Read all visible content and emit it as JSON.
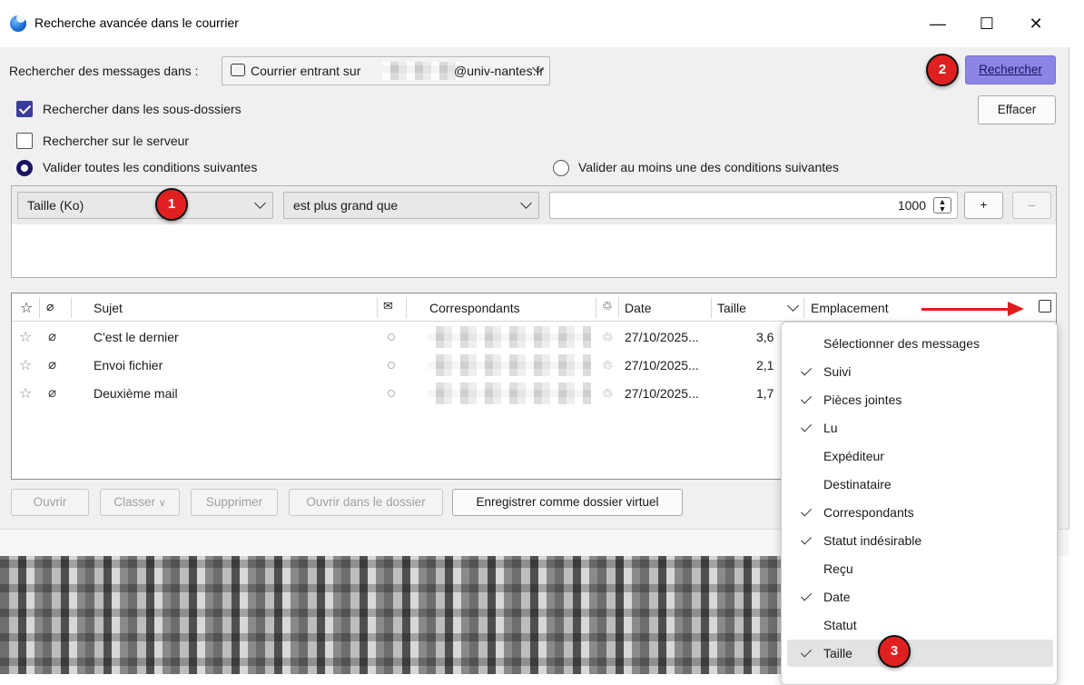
{
  "window": {
    "title": "Recherche avancée dans le courrier",
    "minimize": "—",
    "maximize": "☐",
    "close": "✕"
  },
  "search": {
    "in_label": "Rechercher des messages dans :",
    "folder_prefix": "Courrier entrant sur",
    "folder_suffix": "@univ-nantes.fr",
    "search_button": "Rechercher",
    "clear_button": "Effacer",
    "subfolders_label": "Rechercher dans les sous-dossiers",
    "subfolders_checked": true,
    "server_label": "Rechercher sur le serveur",
    "server_checked": false,
    "match_all_label": "Valider toutes les conditions suivantes",
    "match_any_label": "Valider au moins une des conditions suivantes",
    "match_mode": "all"
  },
  "condition": {
    "field": "Taille (Ko)",
    "operator": "est plus grand que",
    "value": "1000",
    "add": "+",
    "remove": "–"
  },
  "columns": {
    "star": "☆",
    "attachment": "📎",
    "subject": "Sujet",
    "correspondents": "Correspondants",
    "date": "Date",
    "size": "Taille",
    "location": "Emplacement"
  },
  "messages": [
    {
      "subject": "C'est le dernier",
      "date": "27/10/2025...",
      "size": "3,6"
    },
    {
      "subject": "Envoi fichier",
      "date": "27/10/2025...",
      "size": "2,1"
    },
    {
      "subject": "Deuxième mail",
      "date": "27/10/2025...",
      "size": "1,7"
    }
  ],
  "actions": {
    "open": "Ouvrir",
    "file": "Classer",
    "delete": "Supprimer",
    "open_in_folder": "Ouvrir dans le dossier",
    "save_virtual": "Enregistrer comme dossier virtuel"
  },
  "column_menu": [
    {
      "label": "Sélectionner des messages",
      "checked": false
    },
    {
      "label": "Suivi",
      "checked": true
    },
    {
      "label": "Pièces jointes",
      "checked": true
    },
    {
      "label": "Lu",
      "checked": true
    },
    {
      "label": "Expéditeur",
      "checked": false
    },
    {
      "label": "Destinataire",
      "checked": false
    },
    {
      "label": "Correspondants",
      "checked": true
    },
    {
      "label": "Statut indésirable",
      "checked": true
    },
    {
      "label": "Reçu",
      "checked": false
    },
    {
      "label": "Date",
      "checked": true
    },
    {
      "label": "Statut",
      "checked": false
    },
    {
      "label": "Taille",
      "checked": true,
      "highlighted": true
    }
  ],
  "annotations": {
    "badge1": "1",
    "badge2": "2",
    "badge3": "3",
    "accent": "#e02020"
  }
}
